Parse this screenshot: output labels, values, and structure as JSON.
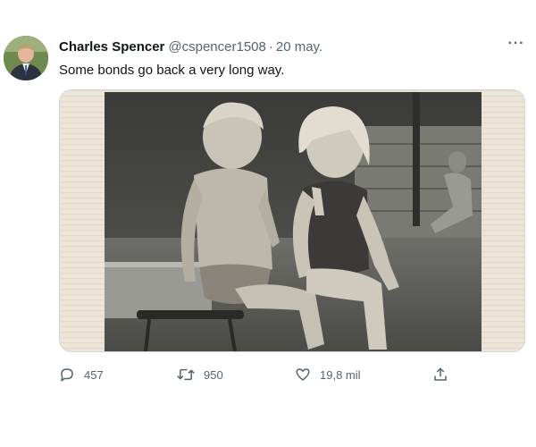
{
  "author": {
    "name": "Charles Spencer",
    "handle": "@cspencer1508",
    "separator": "·",
    "date": "20 may."
  },
  "more_menu_label": "···",
  "tweet_text": "Some bonds go back a very long way.",
  "media": {
    "kind": "vintage black-and-white photograph",
    "icon": "photo"
  },
  "actions": {
    "replies": "457",
    "retweets": "950",
    "likes": "19,8 mil"
  },
  "icons": {
    "reply": "reply-icon",
    "retweet": "retweet-icon",
    "like": "heart-icon",
    "share": "share-icon",
    "more": "more-icon"
  },
  "colors": {
    "text_primary": "#0f1419",
    "text_secondary": "#536471",
    "border": "#cfd9de",
    "background": "#ffffff"
  }
}
